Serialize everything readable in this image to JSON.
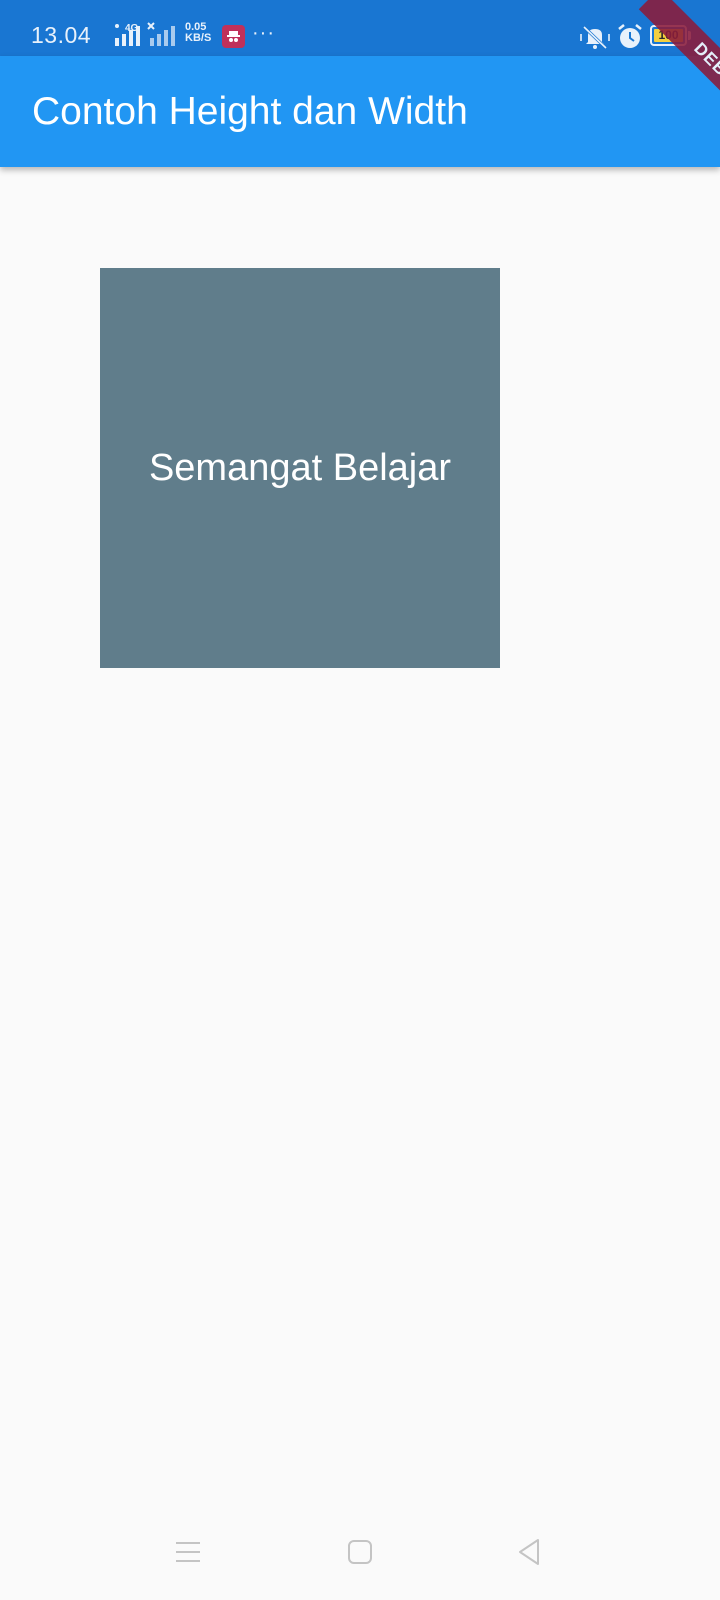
{
  "status_bar": {
    "time": "13.04",
    "network_label": "4G",
    "speed_value": "0.05",
    "speed_unit": "KB/S",
    "more": "···",
    "battery_level": "100",
    "icons": [
      "signal-bars-icon",
      "signal-bars-icon",
      "app-notification-icon",
      "more-icon",
      "mute-vibrate-icon",
      "alarm-icon",
      "battery-icon"
    ]
  },
  "app_bar": {
    "title": "Contoh Height dan Width",
    "color": "#2196f3"
  },
  "debug_banner": {
    "label": "DEBUG"
  },
  "main": {
    "box_text": "Semangat Belajar",
    "box_color": "#607d8b"
  },
  "nav_bar": {
    "icons": [
      "menu-icon",
      "home-icon",
      "back-icon"
    ]
  }
}
